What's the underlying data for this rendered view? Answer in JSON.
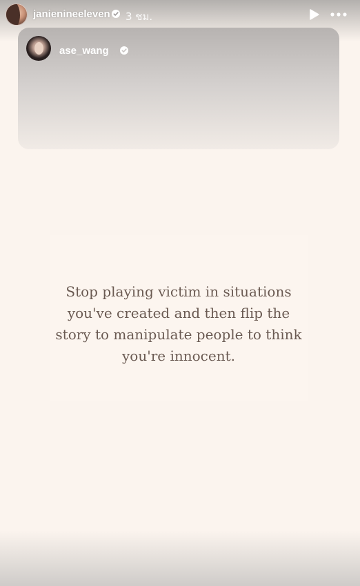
{
  "header": {
    "username": "janienineeleven",
    "time": "3 ชม.",
    "play_icon": "play-icon",
    "more_icon": "more-icon"
  },
  "shared_post": {
    "username": "ase_wang"
  },
  "quote": {
    "text": "Stop playing victim in situations\nyou've created and then flip the\nstory to manipulate people to think\nyou're innocent."
  },
  "colors": {
    "background": "#fbf4ee",
    "quote_text": "#6a5a52"
  }
}
